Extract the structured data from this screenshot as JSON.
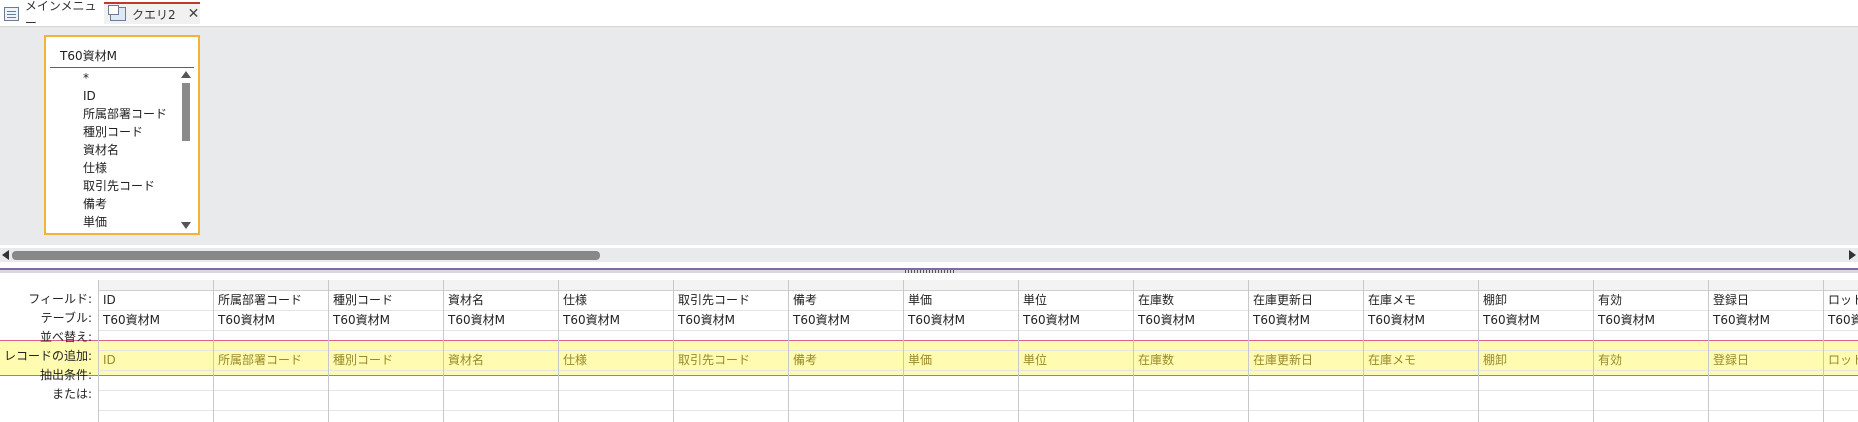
{
  "tabs": [
    {
      "label": "メインメニュー",
      "icon": "form-icon"
    },
    {
      "label": "クエリ2",
      "icon": "query-icon",
      "active": true
    }
  ],
  "table_box": {
    "title": "T60資材M",
    "fields": [
      "*",
      "ID",
      "所属部署コード",
      "種別コード",
      "資材名",
      "仕様",
      "取引先コード",
      "備考",
      "単価"
    ]
  },
  "grid": {
    "row_labels": [
      "フィールド:",
      "テーブル:",
      "並べ替え:",
      "レコードの追加:",
      "抽出条件:",
      "または:"
    ],
    "columns": [
      {
        "field": "ID",
        "table": "T60資材M",
        "append": "ID"
      },
      {
        "field": "所属部署コード",
        "table": "T60資材M",
        "append": "所属部署コード"
      },
      {
        "field": "種別コード",
        "table": "T60資材M",
        "append": "種別コード"
      },
      {
        "field": "資材名",
        "table": "T60資材M",
        "append": "資材名"
      },
      {
        "field": "仕様",
        "table": "T60資材M",
        "append": "仕様"
      },
      {
        "field": "取引先コード",
        "table": "T60資材M",
        "append": "取引先コード"
      },
      {
        "field": "備考",
        "table": "T60資材M",
        "append": "備考"
      },
      {
        "field": "単価",
        "table": "T60資材M",
        "append": "単価"
      },
      {
        "field": "単位",
        "table": "T60資材M",
        "append": "単位"
      },
      {
        "field": "在庫数",
        "table": "T60資材M",
        "append": "在庫数"
      },
      {
        "field": "在庫更新日",
        "table": "T60資材M",
        "append": "在庫更新日"
      },
      {
        "field": "在庫メモ",
        "table": "T60資材M",
        "append": "在庫メモ"
      },
      {
        "field": "棚卸",
        "table": "T60資材M",
        "append": "棚卸"
      },
      {
        "field": "有効",
        "table": "T60資材M",
        "append": "有効"
      },
      {
        "field": "登録日",
        "table": "T60資材M",
        "append": "登録日"
      },
      {
        "field": "ロット",
        "table": "T60資",
        "append": "ロット"
      }
    ]
  },
  "colors": {
    "highlight_row": "#fffbb0",
    "highlight_border": "#e0608a",
    "table_box_border": "#f5b335",
    "active_tab_accent": "#c0392b"
  }
}
